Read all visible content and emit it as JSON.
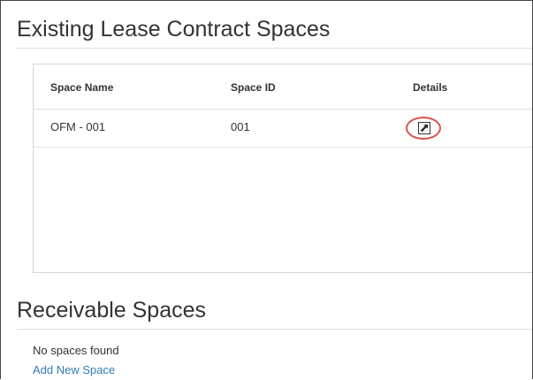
{
  "existing_section": {
    "title": "Existing Lease Contract Spaces",
    "table": {
      "headers": [
        "Space Name",
        "Space ID",
        "Details"
      ],
      "rows": [
        {
          "space_name": "OFM - 001",
          "space_id": "001",
          "details_icon": "open-external-icon"
        }
      ]
    }
  },
  "receivable_section": {
    "title": "Receivable Spaces",
    "empty_message": "No spaces found",
    "add_link": "Add New Space"
  },
  "colors": {
    "link": "#337ab7",
    "highlight_circle": "#d9534f",
    "text": "#333333"
  }
}
